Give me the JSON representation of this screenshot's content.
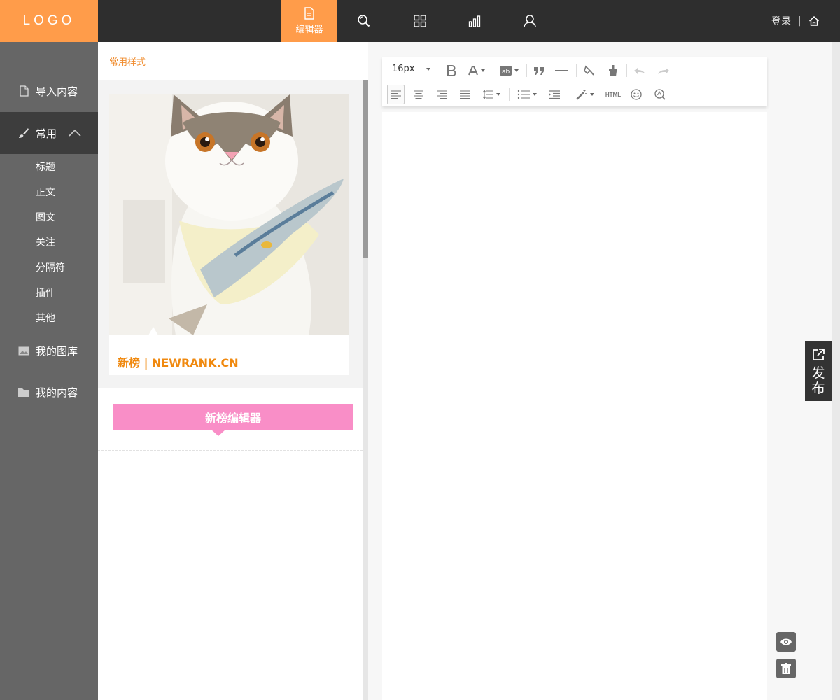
{
  "header": {
    "logo": "LOGO",
    "nav": [
      {
        "label": "编辑器",
        "icon": "document-icon",
        "active": true
      },
      {
        "label": "",
        "icon": "search-icon"
      },
      {
        "label": "",
        "icon": "grid-icon"
      },
      {
        "label": "",
        "icon": "bar-chart-icon"
      },
      {
        "label": "",
        "icon": "user-icon"
      }
    ],
    "login": "登录",
    "separator": "|",
    "home_icon": "home-icon"
  },
  "sidebar": {
    "import": "导入内容",
    "common": "常用",
    "sub_items": [
      "标题",
      "正文",
      "图文",
      "关注",
      "分隔符",
      "插件",
      "其他"
    ],
    "gallery": "我的图库",
    "my_content": "我的内容"
  },
  "panel": {
    "heading": "常用样式",
    "card1_caption": "新榜 | NEWRANK.CN",
    "card2_title": "新榜编辑器"
  },
  "toolbar": {
    "font_size": "16px",
    "html_label": "HTML"
  },
  "actions": {
    "publish": "发布"
  },
  "colors": {
    "accent": "#ff9c4a",
    "topbar": "#2e2e2e",
    "sidebar": "#666666",
    "sidebar_active": "#3d3d3d",
    "caption_orange": "#f0890f",
    "pink": "#f98ec7"
  }
}
